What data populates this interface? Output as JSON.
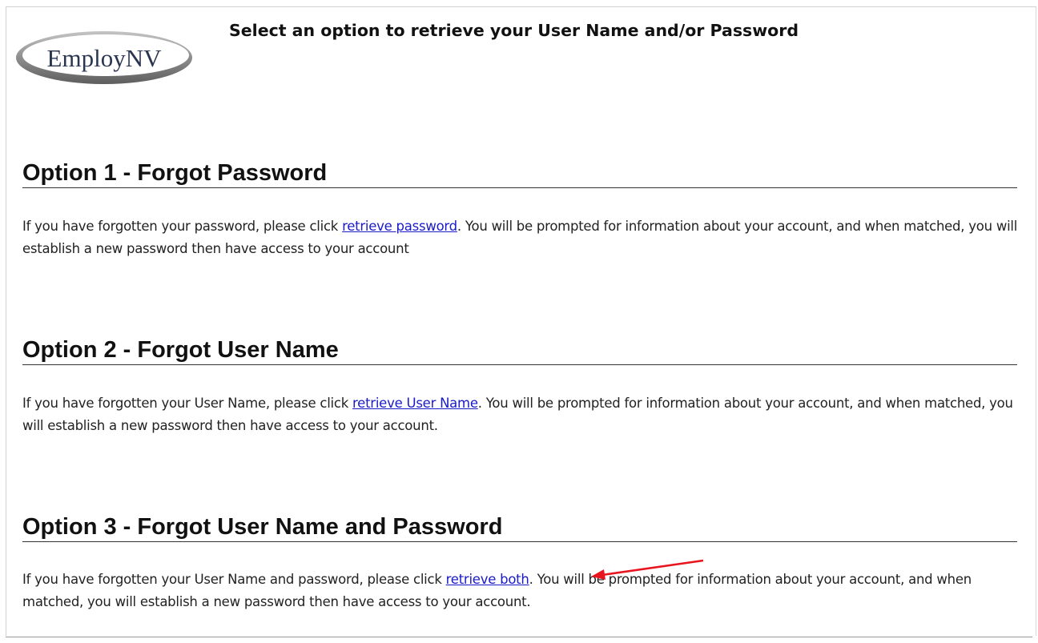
{
  "logo": {
    "text": "EmployNV"
  },
  "page_title": "Select an option to retrieve your User Name and/or Password",
  "sections": [
    {
      "heading": "Option 1 - Forgot Password",
      "text_before": "If you have forgotten your password, please click ",
      "link_text": "retrieve password",
      "text_after": ". You will be prompted for information about your account, and when matched, you will establish a new password then have access to your account"
    },
    {
      "heading": "Option 2 - Forgot User Name",
      "text_before": "If you have forgotten your User Name, please click ",
      "link_text": "retrieve User Name",
      "text_after": ". You will be prompted for information about your account, and when matched, you will establish a new password then have access to your account."
    },
    {
      "heading": "Option 3 - Forgot User Name and Password",
      "text_before": "If you have forgotten your User Name and password, please click ",
      "link_text": "retrieve both",
      "text_after": ". You will be prompted for information about your account, and when matched, you will establish a new password then have access to your account."
    }
  ],
  "colors": {
    "link": "#1a1ac8",
    "annotation_arrow": "#e8141e",
    "logo_swoosh": "#8a8a8a",
    "logo_text": "#2a3550"
  }
}
